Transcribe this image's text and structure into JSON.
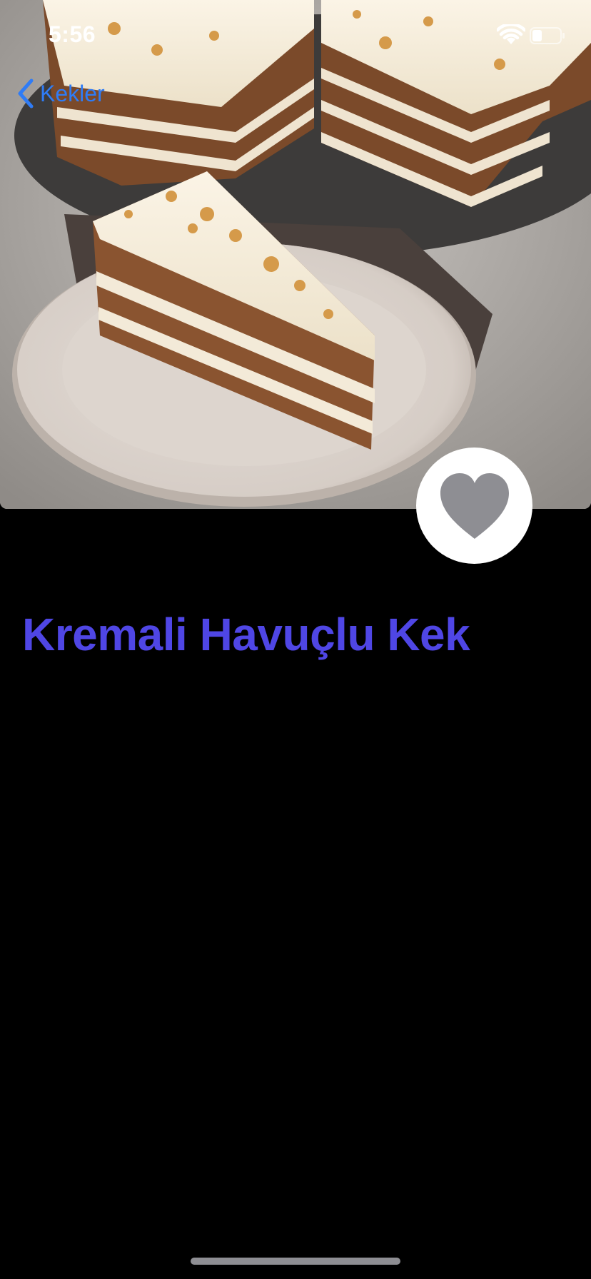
{
  "status_bar": {
    "time": "5:56",
    "wifi_icon": "wifi-icon",
    "battery_icon": "battery-icon",
    "battery_level": 0.35
  },
  "nav": {
    "back_label": "Kekler",
    "back_icon": "chevron-left-icon",
    "accent_color": "#2f7cf6"
  },
  "hero": {
    "image": "carrot-cake-photo"
  },
  "favorite": {
    "icon": "heart-icon",
    "is_favorite": false,
    "icon_color": "#8e8e93"
  },
  "recipe": {
    "title": "Kremali Havuçlu Kek",
    "title_color": "#4f46e5"
  }
}
